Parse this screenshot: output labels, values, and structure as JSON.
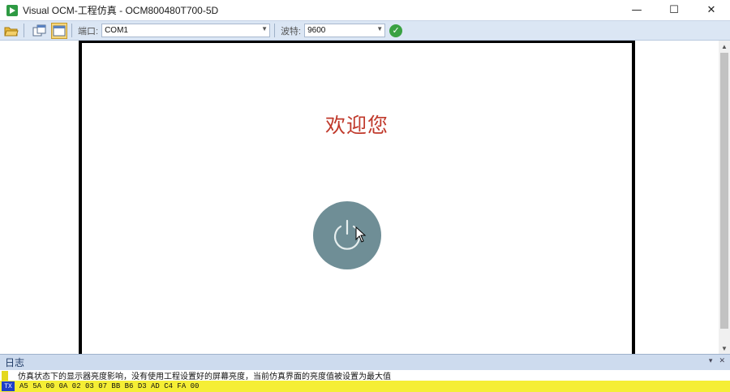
{
  "window": {
    "title": "Visual OCM-工程仿真 - OCM800480T700-5D",
    "minimize": "—",
    "maximize": "☐",
    "close": "✕"
  },
  "toolbar": {
    "open_icon": "folder-open-icon",
    "port_label": "端口:",
    "port_value": "COM1",
    "baud_label": "波特:",
    "baud_value": "9600",
    "connect_icon": "checkmark-icon"
  },
  "screen": {
    "welcome_text": "欢迎您",
    "power_icon": "power-icon",
    "colors": {
      "welcome": "#c0392b",
      "power_button": "#6f8e96"
    }
  },
  "log": {
    "title": "日志",
    "pin_icon": "pin-icon",
    "close_icon": "close-icon",
    "line1": "仿真状态下的显示器亮度影响，没有使用工程设置好的屏幕亮度，当前仿真界面的亮度值被设置为最大值",
    "tx_badge": "TX",
    "line2": "A5 5A 00 0A 02 03 07 BB B6 D3 AD C4 FA 00"
  }
}
